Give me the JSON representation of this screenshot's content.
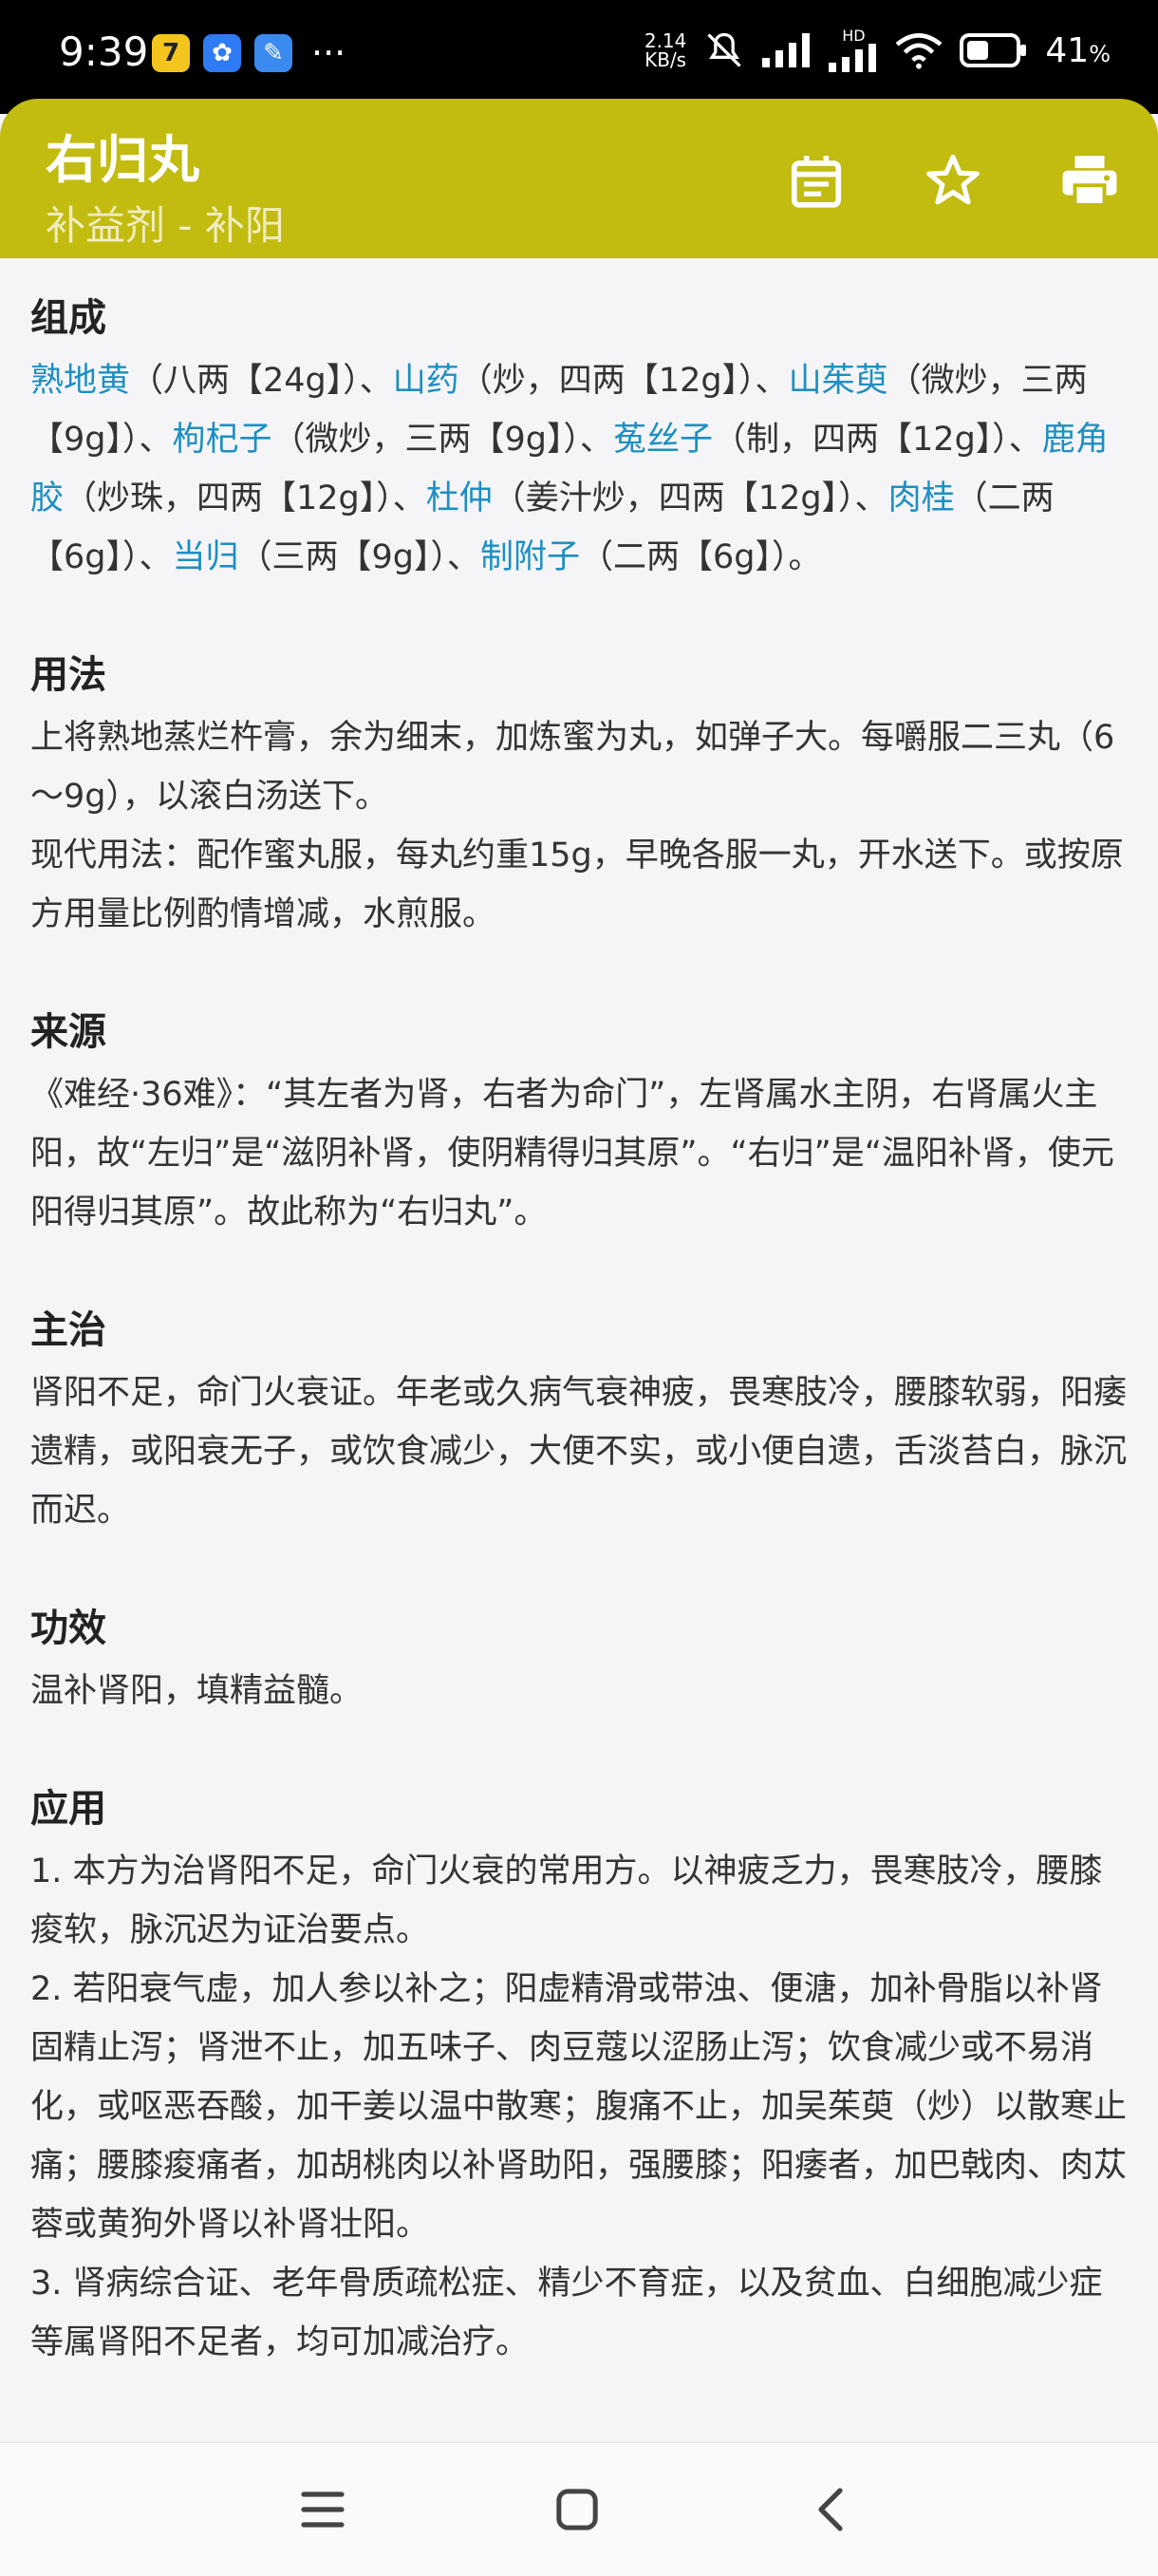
{
  "status": {
    "time": "9:39",
    "speed_value": "2.14",
    "speed_unit": "KB/s",
    "network": "HD",
    "battery": "41"
  },
  "header": {
    "title": "右归丸",
    "subtitle": "补益剂 - 补阳"
  },
  "sections": {
    "composition": {
      "title": "组成",
      "segments": [
        {
          "text": "熟地黄",
          "herb": true
        },
        {
          "text": "（八两【24g】）、",
          "herb": false
        },
        {
          "text": "山药",
          "herb": true
        },
        {
          "text": "（炒，四两【12g】）、",
          "herb": false
        },
        {
          "text": "山茱萸",
          "herb": true
        },
        {
          "text": "（微炒，三两【9g】）、",
          "herb": false
        },
        {
          "text": "枸杞子",
          "herb": true
        },
        {
          "text": "（微炒，三两【9g】）、",
          "herb": false
        },
        {
          "text": "菟丝子",
          "herb": true
        },
        {
          "text": "（制，四两【12g】）、",
          "herb": false
        },
        {
          "text": "鹿角胶",
          "herb": true
        },
        {
          "text": "（炒珠，四两【12g】）、",
          "herb": false
        },
        {
          "text": "杜仲",
          "herb": true
        },
        {
          "text": "（姜汁炒，四两【12g】）、",
          "herb": false
        },
        {
          "text": "肉桂",
          "herb": true
        },
        {
          "text": "（二两【6g】）、",
          "herb": false
        },
        {
          "text": "当归",
          "herb": true
        },
        {
          "text": "（三两【9g】）、",
          "herb": false
        },
        {
          "text": "制附子",
          "herb": true
        },
        {
          "text": "（二两【6g】）。",
          "herb": false
        }
      ]
    },
    "usage": {
      "title": "用法",
      "p1": "上将熟地蒸烂杵膏，余为细末，加炼蜜为丸，如弹子大。每嚼服二三丸（6～9g），以滚白汤送下。",
      "p2": "现代用法：配作蜜丸服，每丸约重15g，早晚各服一丸，开水送下。或按原方用量比例酌情增减，水煎服。"
    },
    "source": {
      "title": "来源",
      "p1": "《难经·36难》：“其左者为肾，右者为命门”，左肾属水主阴，右肾属火主阳，故“左归”是“滋阴补肾，使阴精得归其原”。“右归”是“温阳补肾，使元阳得归其原”。故此称为“右归丸”。"
    },
    "indication": {
      "title": "主治",
      "p1": "肾阳不足，命门火衰证。年老或久病气衰神疲，畏寒肢冷，腰膝软弱，阳痿遗精，或阳衰无子，或饮食减少，大便不实，或小便自遗，舌淡苔白，脉沉而迟。"
    },
    "effect": {
      "title": "功效",
      "p1": "温补肾阳，填精益髓。"
    },
    "application": {
      "title": "应用",
      "p1": "1. 本方为治肾阳不足，命门火衰的常用方。以神疲乏力，畏寒肢冷，腰膝痠软，脉沉迟为证治要点。",
      "p2": "2. 若阳衰气虚，加人参以补之；阳虚精滑或带浊、便溏，加补骨脂以补肾固精止泻；肾泄不止，加五味子、肉豆蔻以涩肠止泻；饮食减少或不易消化，或呕恶吞酸，加干姜以温中散寒；腹痛不止，加吴茱萸（炒）以散寒止痛；腰膝痠痛者，加胡桃肉以补肾助阳，强腰膝；阳痿者，加巴戟肉、肉苁蓉或黄狗外肾以补肾壮阳。",
      "p3": "3. 肾病综合证、老年骨质疏松症、精少不育症，以及贫血、白细胞减少症等属肾阳不足者，均可加减治疗。"
    }
  },
  "colors": {
    "app_bar": "#c2bb10",
    "herb_link": "#1d8fc2"
  },
  "icons": {
    "calendar": "calendar-icon",
    "favorite": "star-icon",
    "print": "printer-icon"
  }
}
